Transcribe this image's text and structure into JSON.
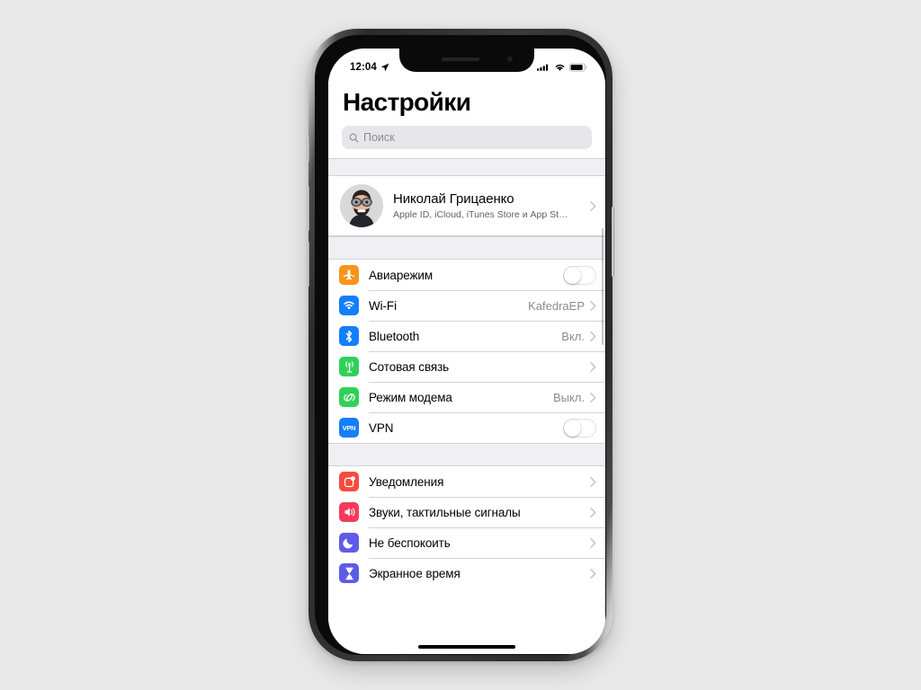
{
  "device": {
    "name": "iPhone X",
    "frame_color": "#2b2b2b",
    "screen_bg": "#ffffff",
    "canvas_bg": "#e9e9e9"
  },
  "status_bar": {
    "time": "12:04",
    "location_icon": "location-arrow-icon",
    "cellular_icon": "cellular-bars-icon",
    "wifi_icon": "wifi-icon",
    "battery_icon": "battery-icon",
    "battery_level": 85
  },
  "header": {
    "title": "Настройки"
  },
  "search": {
    "placeholder": "Поиск",
    "value": "",
    "icon": "search-icon"
  },
  "profile": {
    "avatar_icon": "memoji-avatar",
    "name": "Николай Грицаенко",
    "subtitle": "Apple ID, iCloud, iTunes Store и App St…",
    "chevron": "chevron-right-icon"
  },
  "groups": [
    {
      "id": "connectivity",
      "rows": [
        {
          "id": "airplane-mode",
          "label": "Авиарежим",
          "icon": "airplane-icon",
          "icon_color": "#f8941d",
          "control": "toggle",
          "toggle_on": false,
          "value": ""
        },
        {
          "id": "wifi",
          "label": "Wi-Fi",
          "icon": "wifi-icon",
          "icon_color": "#147efb",
          "control": "chevron",
          "value": "KafedraEP"
        },
        {
          "id": "bluetooth",
          "label": "Bluetooth",
          "icon": "bluetooth-icon",
          "icon_color": "#147efb",
          "control": "chevron",
          "value": "Вкл."
        },
        {
          "id": "cellular",
          "label": "Сотовая связь",
          "icon": "cellular-antenna-icon",
          "icon_color": "#30d158",
          "control": "chevron",
          "value": ""
        },
        {
          "id": "personal-hotspot",
          "label": "Режим модема",
          "icon": "hotspot-link-icon",
          "icon_color": "#30d158",
          "control": "chevron",
          "value": "Выкл."
        },
        {
          "id": "vpn",
          "label": "VPN",
          "icon": "vpn-icon",
          "icon_color": "#147efb",
          "control": "toggle",
          "toggle_on": false,
          "value": ""
        }
      ]
    },
    {
      "id": "alerts",
      "rows": [
        {
          "id": "notifications",
          "label": "Уведомления",
          "icon": "notification-badge-icon",
          "icon_color": "#f84b3d",
          "control": "chevron",
          "value": ""
        },
        {
          "id": "sounds-haptics",
          "label": "Звуки, тактильные сигналы",
          "icon": "speaker-icon",
          "icon_color": "#f73a5c",
          "control": "chevron",
          "value": ""
        },
        {
          "id": "do-not-disturb",
          "label": "Не беспокоить",
          "icon": "moon-icon",
          "icon_color": "#5e5ce6",
          "control": "chevron",
          "value": ""
        },
        {
          "id": "screen-time",
          "label": "Экранное время",
          "icon": "hourglass-icon",
          "icon_color": "#5e5ce6",
          "control": "chevron",
          "value": ""
        }
      ]
    }
  ]
}
